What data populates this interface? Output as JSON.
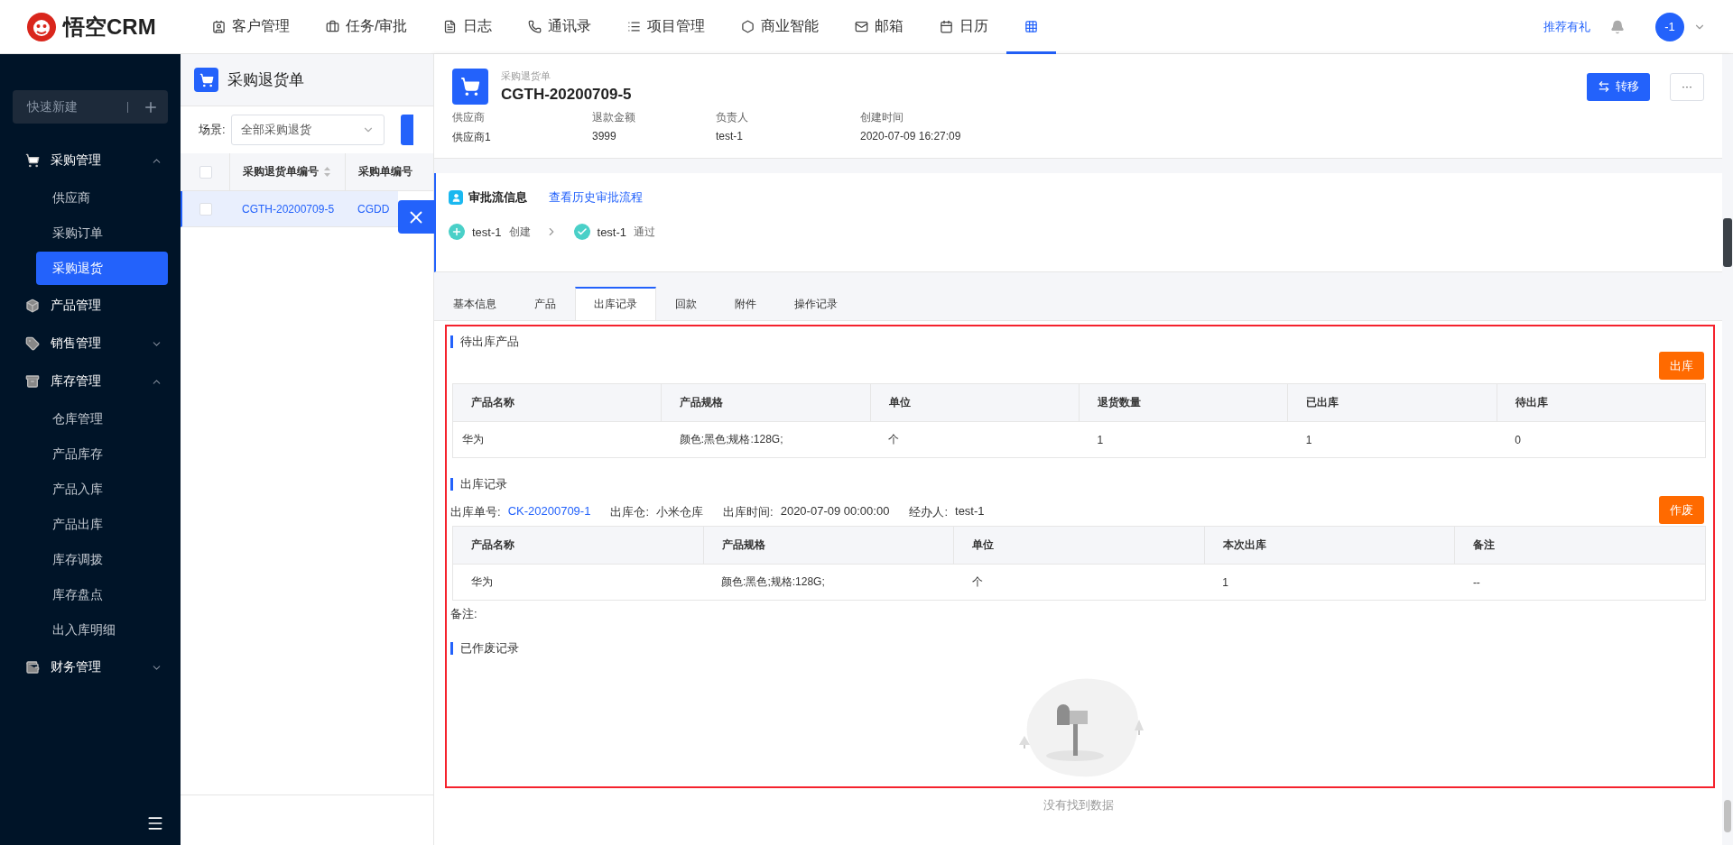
{
  "topbar": {
    "logo": "悟空CRM",
    "nav": [
      {
        "label": "客户管理",
        "selected": false
      },
      {
        "label": "任务/审批",
        "selected": false
      },
      {
        "label": "日志",
        "selected": false
      },
      {
        "label": "通讯录",
        "selected": false
      },
      {
        "label": "项目管理",
        "selected": false
      },
      {
        "label": "商业智能",
        "selected": false
      },
      {
        "label": "邮箱",
        "selected": false
      },
      {
        "label": "日历",
        "selected": false
      },
      {
        "selected": true
      }
    ],
    "referral": "推荐有礼",
    "avatar": "-1"
  },
  "sidebar": {
    "quick_create": "快速新建",
    "groups": [
      {
        "label": "采购管理",
        "expanded": true,
        "children": [
          {
            "label": "供应商",
            "selected": false
          },
          {
            "label": "采购订单",
            "selected": false
          },
          {
            "label": "采购退货",
            "selected": true
          }
        ]
      },
      {
        "label": "产品管理"
      },
      {
        "label": "销售管理",
        "expanded": false
      },
      {
        "label": "库存管理",
        "expanded": true,
        "children": [
          {
            "label": "仓库管理",
            "selected": false
          },
          {
            "label": "产品库存",
            "selected": false
          },
          {
            "label": "产品入库",
            "selected": false
          },
          {
            "label": "产品出库",
            "selected": false
          },
          {
            "label": "库存调拨",
            "selected": false
          },
          {
            "label": "库存盘点",
            "selected": false
          },
          {
            "label": "出入库明细",
            "selected": false
          }
        ]
      },
      {
        "label": "财务管理",
        "expanded": false
      }
    ]
  },
  "list": {
    "title": "采购退货单",
    "scene_label": "场景:",
    "scene_value": "全部采购退货",
    "columns": [
      "采购退货单编号",
      "采购单编号"
    ],
    "rows": [
      {
        "cells": [
          "CGTH-20200709-5",
          "CGDD"
        ],
        "selected": true,
        "checked": false
      }
    ],
    "all_checked": false
  },
  "detail": {
    "type_label": "采购退货单",
    "title": "CGTH-20200709-5",
    "actions": {
      "transfer": "转移",
      "more": "···"
    },
    "fields": [
      {
        "label": "供应商",
        "value": "供应商1"
      },
      {
        "label": "退款金额",
        "value": "3999"
      },
      {
        "label": "负责人",
        "value": "test-1"
      },
      {
        "label": "创建时间",
        "value": "2020-07-09 16:27:09"
      }
    ],
    "approval": {
      "title": "审批流信息",
      "history_link": "查看历史审批流程",
      "steps": [
        {
          "kind": "create",
          "name": "test-1",
          "action": "创建"
        },
        {
          "kind": "pass",
          "name": "test-1",
          "action": "通过"
        }
      ]
    },
    "tabs": [
      {
        "label": "基本信息",
        "selected": false
      },
      {
        "label": "产品",
        "selected": false
      },
      {
        "label": "出库记录",
        "selected": true
      },
      {
        "label": "回款",
        "selected": false
      },
      {
        "label": "附件",
        "selected": false
      },
      {
        "label": "操作记录",
        "selected": false
      }
    ],
    "pending": {
      "title": "待出库产品",
      "button": "出库",
      "columns": [
        "产品名称",
        "产品规格",
        "单位",
        "退货数量",
        "已出库",
        "待出库"
      ],
      "rows": [
        [
          "华为",
          "颜色:黑色;规格:128G;",
          "个",
          "1",
          "1",
          "0"
        ]
      ]
    },
    "records": {
      "title": "出库记录",
      "info": [
        {
          "label": "出库单号:",
          "value": "CK-20200709-1",
          "kind": "link"
        },
        {
          "label": "出库仓:",
          "value": "小米仓库",
          "kind": "text"
        },
        {
          "label": "出库时间:",
          "value": "2020-07-09 00:00:00",
          "kind": "text"
        },
        {
          "label": "经办人:",
          "value": "test-1",
          "kind": "text"
        }
      ],
      "button": "作废",
      "columns": [
        "产品名称",
        "产品规格",
        "单位",
        "本次出库",
        "备注"
      ],
      "rows": [
        [
          "华为",
          "颜色:黑色;规格:128G;",
          "个",
          "1",
          "--"
        ]
      ],
      "note": "备注:"
    },
    "voided": {
      "title": "已作废记录",
      "empty_text": "没有找到数据"
    }
  }
}
